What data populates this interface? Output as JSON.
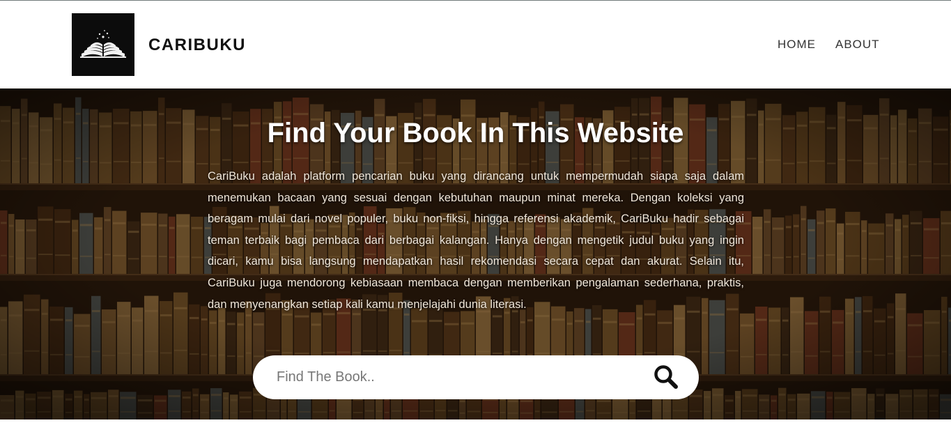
{
  "header": {
    "brand": "CARIBUKU",
    "nav": [
      {
        "label": "HOME"
      },
      {
        "label": "ABOUT"
      }
    ]
  },
  "hero": {
    "title": "Find Your Book In This Website",
    "description": "CariBuku adalah platform pencarian buku yang dirancang untuk mempermudah siapa saja dalam menemukan bacaan yang sesuai dengan kebutuhan maupun minat mereka. Dengan koleksi yang beragam mulai dari novel populer, buku non-fiksi, hingga referensi akademik, CariBuku hadir sebagai teman terbaik bagi pembaca dari berbagai kalangan. Hanya dengan mengetik judul buku yang ingin dicari, kamu bisa langsung mendapatkan hasil rekomendasi secara cepat dan akurat. Selain itu, CariBuku juga mendorong kebiasaan membaca dengan memberikan pengalaman sederhana, praktis, dan menyenangkan setiap kali kamu menjelajahi dunia literasi."
  },
  "search": {
    "placeholder": "Find The Book..",
    "value": "",
    "icon": "search-icon"
  },
  "colors": {
    "header_bg": "#ffffff",
    "logo_bg": "#0c0c0c",
    "hero_overlay": "#2a1a0c",
    "title_text": "#ffffff"
  }
}
